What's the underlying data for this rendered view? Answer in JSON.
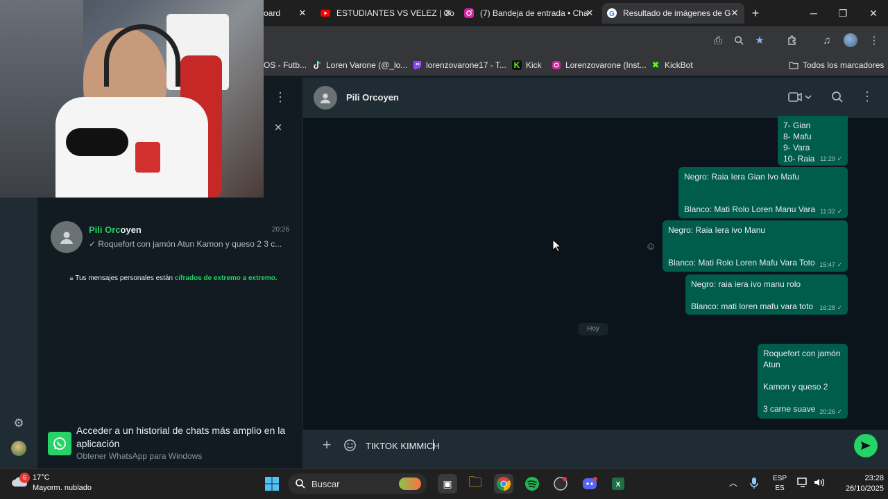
{
  "browser": {
    "tabs": [
      {
        "label": "oard",
        "icon": "dashboard-icon"
      },
      {
        "label": "ESTUDIANTES VS VELEZ | Co",
        "icon": "youtube-icon"
      },
      {
        "label": "(7) Bandeja de entrada • Cha",
        "icon": "instagram-icon"
      },
      {
        "label": "Resultado de imágenes de G",
        "icon": "google-icon"
      }
    ],
    "new_tab_label": "+",
    "bookmarks": [
      {
        "label": "OS - Futb...",
        "icon": "bookmark-icon"
      },
      {
        "label": "Loren Varone (@_lo...",
        "icon": "tiktok-icon"
      },
      {
        "label": "lorenzovarone17 - T...",
        "icon": "twitch-icon"
      },
      {
        "label": "Kick",
        "icon": "kick-icon"
      },
      {
        "label": "Lorenzovarone (Inst...",
        "icon": "instagram-icon"
      },
      {
        "label": "KickBot",
        "icon": "kickbot-icon"
      }
    ],
    "all_bookmarks_label": "Todos los marcadores",
    "colors": {
      "tabstrip": "#1f1f1f",
      "toolbar": "#35363a"
    }
  },
  "whatsapp": {
    "sidebar": {
      "chat": {
        "name_highlight": "Pili Orc",
        "name_rest": "oyen",
        "time": "20:26",
        "preview": "✓ Roquefort con jamón  Atun Kamon y queso 2 3 c..."
      },
      "encryption_prefix": "Tus mensajes personales están ",
      "encryption_link": "cifrados de extremo a extremo.",
      "promo_title": "Acceder a un historial de chats más amplio en la aplicación",
      "promo_subtitle": "Obtener WhatsApp para Windows"
    },
    "header": {
      "contact_name": "Pili Orcoyen"
    },
    "messages": [
      {
        "lines": [
          "7- Gian",
          "8- Mafu",
          "9- Vara",
          "10- Raia"
        ],
        "time": "11:29"
      },
      {
        "lines": [
          "Negro: Raia Iera Gian Ivo Mafu",
          "",
          "Blanco: Mati Rolo Loren Manu Vara"
        ],
        "time": "11:32"
      },
      {
        "lines": [
          "Negro: Raia Iera ivo Manu",
          "",
          "Blanco: Mati Rolo Loren Mafu Vara Toto"
        ],
        "time": "15:47"
      },
      {
        "lines": [
          "Negro: raia iera ivo manu rolo",
          "",
          "Blanco: mati loren mafu vara toto"
        ],
        "time": "16:28"
      },
      {
        "lines": [
          "Roquefort con jamón",
          "Atun",
          "",
          "Kamon y queso 2",
          "",
          "3 carne suave"
        ],
        "time": "20:26"
      }
    ],
    "day_separator": "Hoy",
    "composer": {
      "value": "TIKTOK KIMMICH"
    },
    "colors": {
      "accent": "#25d366",
      "outgoing_bubble": "#005c4b",
      "background": "#0b141a"
    }
  },
  "taskbar": {
    "weather_temp": "17°C",
    "weather_desc": "Mayorm. nublado",
    "weather_badge": "6",
    "search_label": "Buscar",
    "lang_top": "ESP",
    "lang_bottom": "ES",
    "time": "23:28",
    "date": "26/10/2025"
  }
}
